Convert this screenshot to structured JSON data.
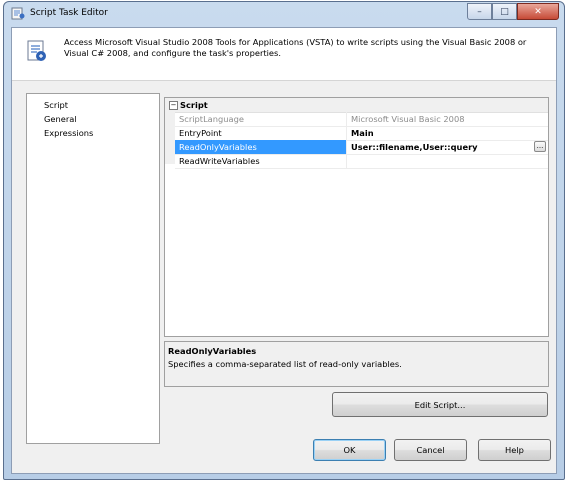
{
  "window": {
    "title": "Script Task Editor"
  },
  "header": {
    "description": "Access Microsoft Visual Studio 2008 Tools for Applications (VSTA) to write scripts using the Visual Basic 2008 or Visual C# 2008, and configure the task's properties."
  },
  "nav": {
    "items": [
      "Script",
      "General",
      "Expressions"
    ],
    "selected": "Script"
  },
  "grid": {
    "category": "Script",
    "properties": [
      {
        "name": "ScriptLanguage",
        "value": "Microsoft Visual Basic 2008"
      },
      {
        "name": "EntryPoint",
        "value": "Main"
      },
      {
        "name": "ReadOnlyVariables",
        "value": "User::filename,User::query"
      },
      {
        "name": "ReadWriteVariables",
        "value": ""
      }
    ],
    "ellipsis_label": "..."
  },
  "description": {
    "title": "ReadOnlyVariables",
    "text": "Specifies a comma-separated list of read-only variables."
  },
  "buttons": {
    "edit_script": "Edit Script...",
    "ok": "OK",
    "cancel": "Cancel",
    "help": "Help"
  },
  "colors": {
    "selection": "#3399ff",
    "disabled_text": "#8c8c8c",
    "dialog_bg": "#f0f0f0"
  }
}
